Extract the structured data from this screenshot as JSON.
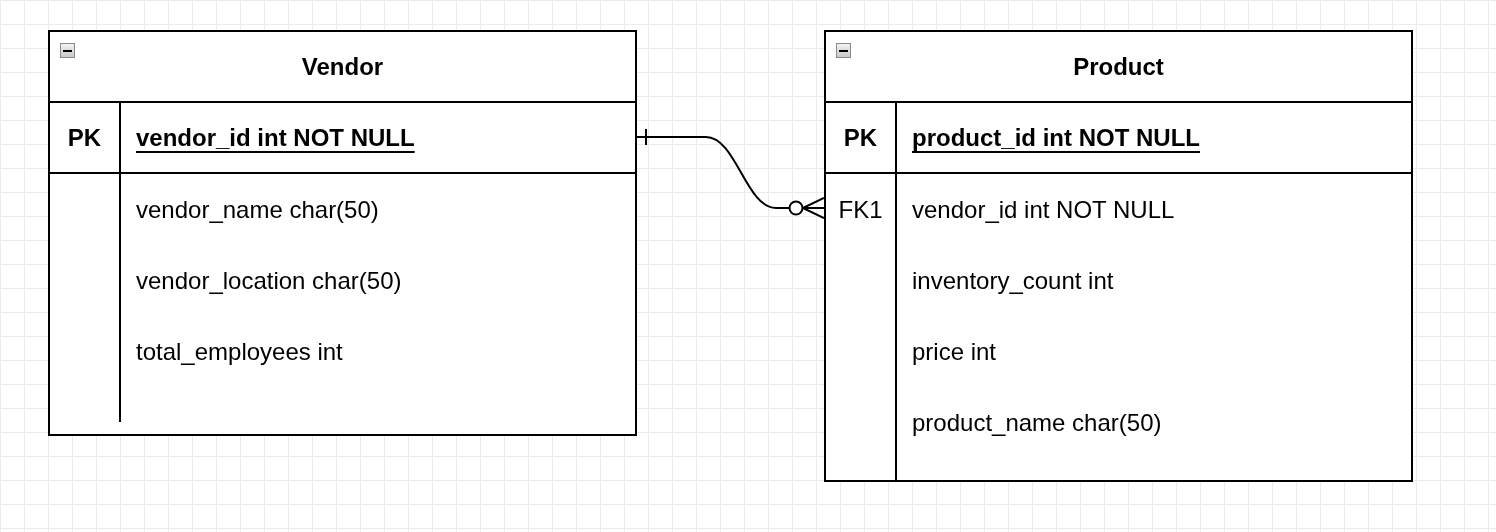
{
  "tables": [
    {
      "title": "Vendor",
      "collapsed": false,
      "primary_key": {
        "key": "PK",
        "field": "vendor_id int NOT NULL"
      },
      "rows": [
        {
          "key": "",
          "field": "vendor_name char(50)"
        },
        {
          "key": "",
          "field": "vendor_location char(50)"
        },
        {
          "key": "",
          "field": "total_employees int"
        }
      ]
    },
    {
      "title": "Product",
      "collapsed": false,
      "primary_key": {
        "key": "PK",
        "field": "product_id int NOT NULL"
      },
      "rows": [
        {
          "key": "FK1",
          "field": "vendor_id int NOT NULL"
        },
        {
          "key": "",
          "field": "inventory_count int"
        },
        {
          "key": "",
          "field": "price int"
        },
        {
          "key": "",
          "field": "product_name char(50)"
        }
      ]
    }
  ]
}
